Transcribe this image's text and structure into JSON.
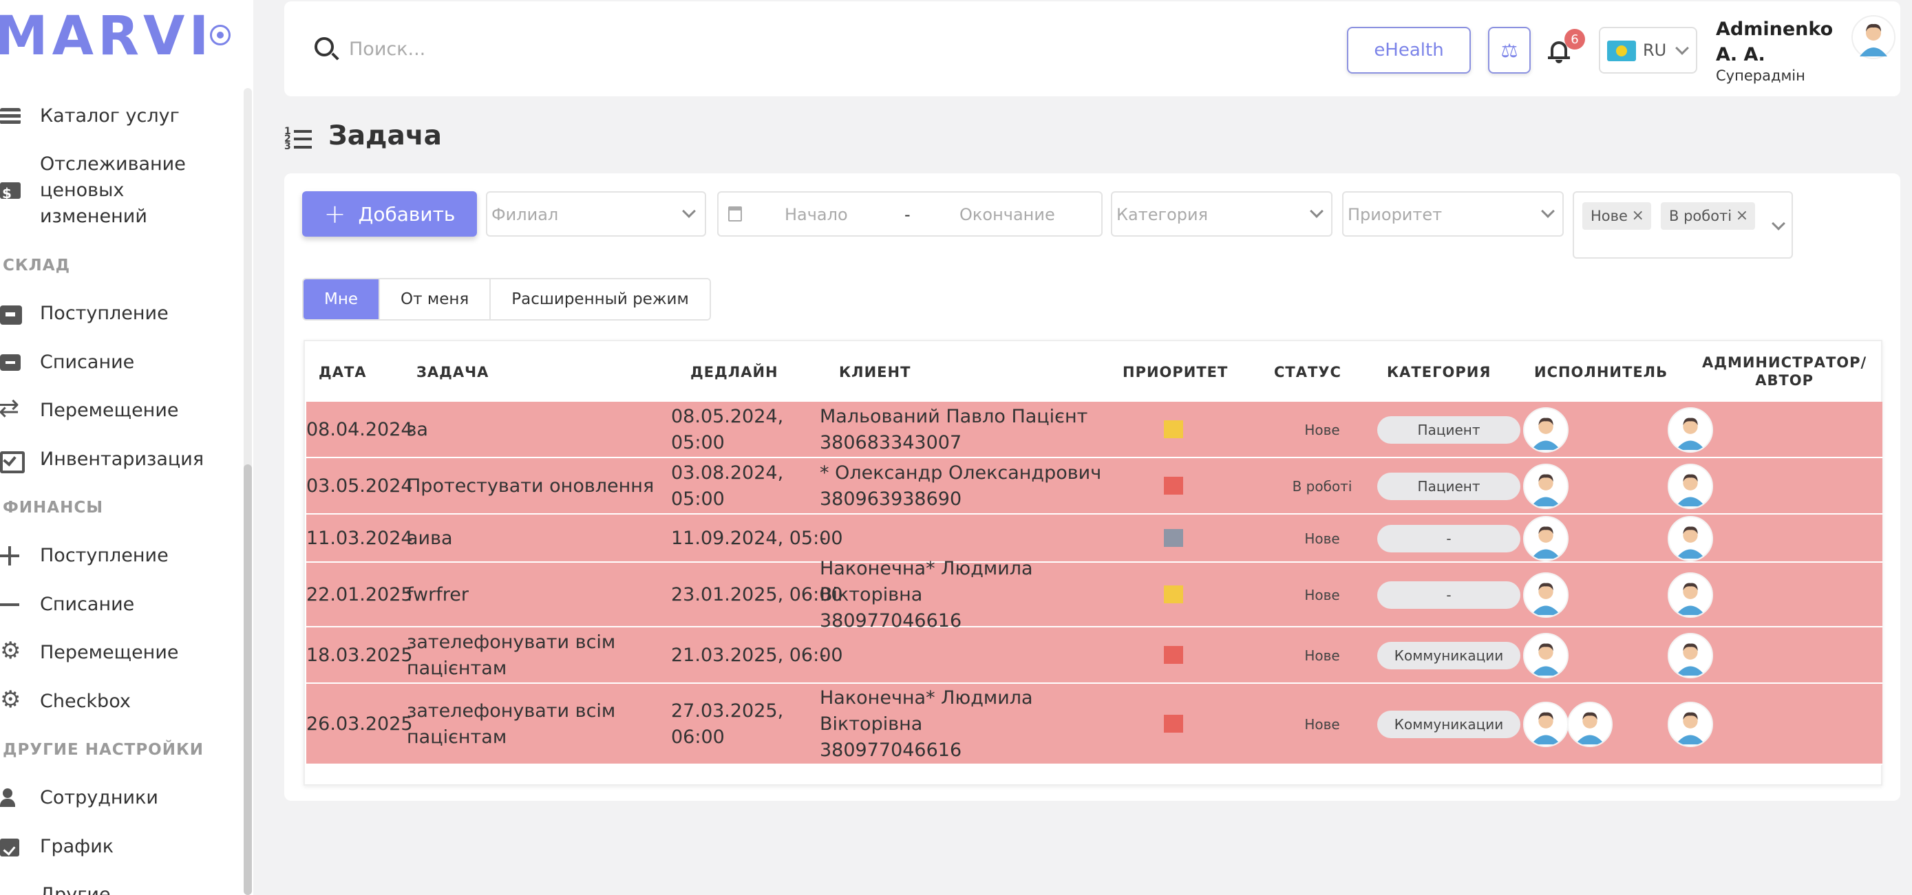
{
  "sidebar": {
    "logo": "MARVI",
    "items": [
      {
        "label": "Каталог услуг",
        "icon": "list-icon"
      },
      {
        "label": "Отслеживание ценовых изменений",
        "icon": "price-tag-icon"
      },
      {
        "section": "СКЛАД"
      },
      {
        "label": "Поступление",
        "icon": "box-plus-icon"
      },
      {
        "label": "Списание",
        "icon": "box-minus-icon"
      },
      {
        "label": "Перемещение",
        "icon": "arrows-icon"
      },
      {
        "label": "Инвентаризация",
        "icon": "checklist-icon"
      },
      {
        "section": "ФИНАНСЫ"
      },
      {
        "label": "Поступление",
        "icon": "plus-icon"
      },
      {
        "label": "Списание",
        "icon": "minus-icon"
      },
      {
        "label": "Перемещение",
        "icon": "money-transfer-icon"
      },
      {
        "label": "Checkbox",
        "icon": "money-gear-icon"
      },
      {
        "section": "ДРУГИЕ НАСТРОЙКИ"
      },
      {
        "label": "Сотрудники",
        "icon": "users-gear-icon"
      },
      {
        "label": "График",
        "icon": "calendar-check-icon"
      },
      {
        "label": "Другие",
        "icon": "more-icon"
      }
    ],
    "price_tracking_lines": [
      "Отслеживание",
      "ценовых",
      "изменений"
    ]
  },
  "header": {
    "search_placeholder": "Поиск...",
    "ehealth_label": "eHealth",
    "notification_count": "6",
    "language": "RU",
    "user_name_line1": "Adminenko",
    "user_name_line2": "А. А.",
    "user_role": "Суперадмін"
  },
  "page": {
    "title": "Задача"
  },
  "toolbar": {
    "add_label": "Добавить",
    "branch_placeholder": "Филиал",
    "start_placeholder": "Начало",
    "date_separator": "-",
    "end_placeholder": "Окончание",
    "category_placeholder": "Категория",
    "priority_placeholder": "Приоритет",
    "status_chips": [
      "Нове",
      "В роботі"
    ]
  },
  "tabs": [
    "Мне",
    "От меня",
    "Расширенный режим"
  ],
  "active_tab": "Мне",
  "table": {
    "headers": {
      "date": "ДАТА",
      "task": "ЗАДАЧА",
      "deadline": "ДЕДЛАЙН",
      "client": "КЛИЕНТ",
      "priority": "ПРИОРИТЕТ",
      "status": "СТАТУС",
      "category": "КАТЕГОРИЯ",
      "executor": "ИСПОЛНИТЕЛЬ",
      "admin_line1": "АДМИНИСТРАТОР/",
      "admin_line2": "АВТОР"
    },
    "rows": [
      {
        "date": "08.04.2024",
        "task": [
          "за"
        ],
        "deadline": [
          "08.05.2024,",
          "05:00"
        ],
        "client": [
          "Мальований Павло Пацієнт",
          "380683343007"
        ],
        "priority_color": "#f3c942",
        "status": "Нове",
        "category": "Пациент",
        "executors": 1
      },
      {
        "date": "03.05.2024",
        "task": [
          "Протестувати оновлення"
        ],
        "deadline": [
          "03.08.2024,",
          "05:00"
        ],
        "client": [
          "* Олександр Олександрович",
          "380963938690"
        ],
        "priority_color": "#e8635c",
        "status": "В роботі",
        "category": "Пациент",
        "executors": 1
      },
      {
        "date": "11.03.2024",
        "task": [
          "аива"
        ],
        "deadline": [
          "11.09.2024, 05:00"
        ],
        "client": [
          "-"
        ],
        "priority_color": "#8e96a6",
        "status": "Нове",
        "category": "-",
        "executors": 1
      },
      {
        "date": "22.01.2025",
        "task": [
          "fwrfrer"
        ],
        "deadline": [
          "23.01.2025, 06:00"
        ],
        "client": [
          "Наконечна* Людмила",
          "Вікторівна",
          "380977046616"
        ],
        "priority_color": "#f3c942",
        "status": "Нове",
        "category": "-",
        "executors": 1
      },
      {
        "date": "18.03.2025",
        "task": [
          "зателефонувати всім",
          "пацієнтам"
        ],
        "deadline": [
          "21.03.2025, 06:00"
        ],
        "client": [
          "-"
        ],
        "priority_color": "#e8635c",
        "status": "Нове",
        "category": "Коммуникации",
        "executors": 1
      },
      {
        "date": "26.03.2025",
        "task": [
          "зателефонувати всім",
          "пацієнтам"
        ],
        "deadline": [
          "27.03.2025,",
          "06:00"
        ],
        "client": [
          "Наконечна* Людмила",
          "Вікторівна",
          "380977046616"
        ],
        "priority_color": "#e8635c",
        "status": "Нове",
        "category": "Коммуникации",
        "executors": 2
      }
    ]
  },
  "colors": {
    "accent": "#7f87ef",
    "row_highlight": "#f0a5a5",
    "badge": "#e46a6a"
  }
}
